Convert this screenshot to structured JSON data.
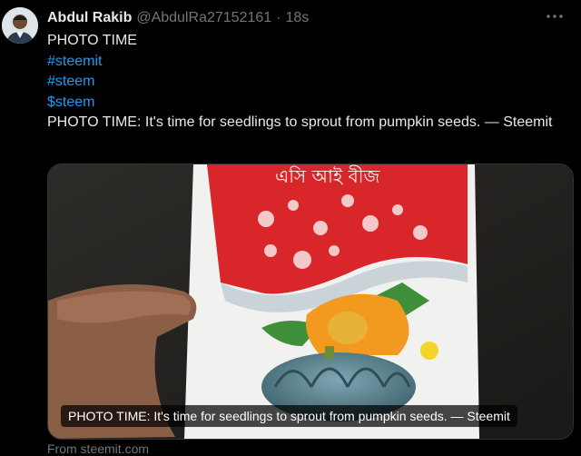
{
  "author": {
    "display_name": "Abdul Rakib",
    "handle": "@AbdulRa27152161",
    "separator": "·",
    "time": "18s"
  },
  "tweet": {
    "line1": "PHOTO TIME",
    "hashtag1": "#steemit",
    "hashtag2": "#steem",
    "cashtag": "$steem",
    "line_desc": "PHOTO TIME: It's time for seedlings to sprout from pumpkin seeds. — Steemit"
  },
  "card": {
    "caption": "PHOTO TIME: It's time for seedlings to sprout from pumpkin seeds. — Steemit",
    "packet_text": "এসি আই বীজ",
    "source": "From steemit.com"
  },
  "icons": {
    "more": "more-horizontal-icon"
  },
  "colors": {
    "background": "#000000",
    "text": "#e7e9ea",
    "muted": "#71767b",
    "link": "#1d9bf0"
  }
}
